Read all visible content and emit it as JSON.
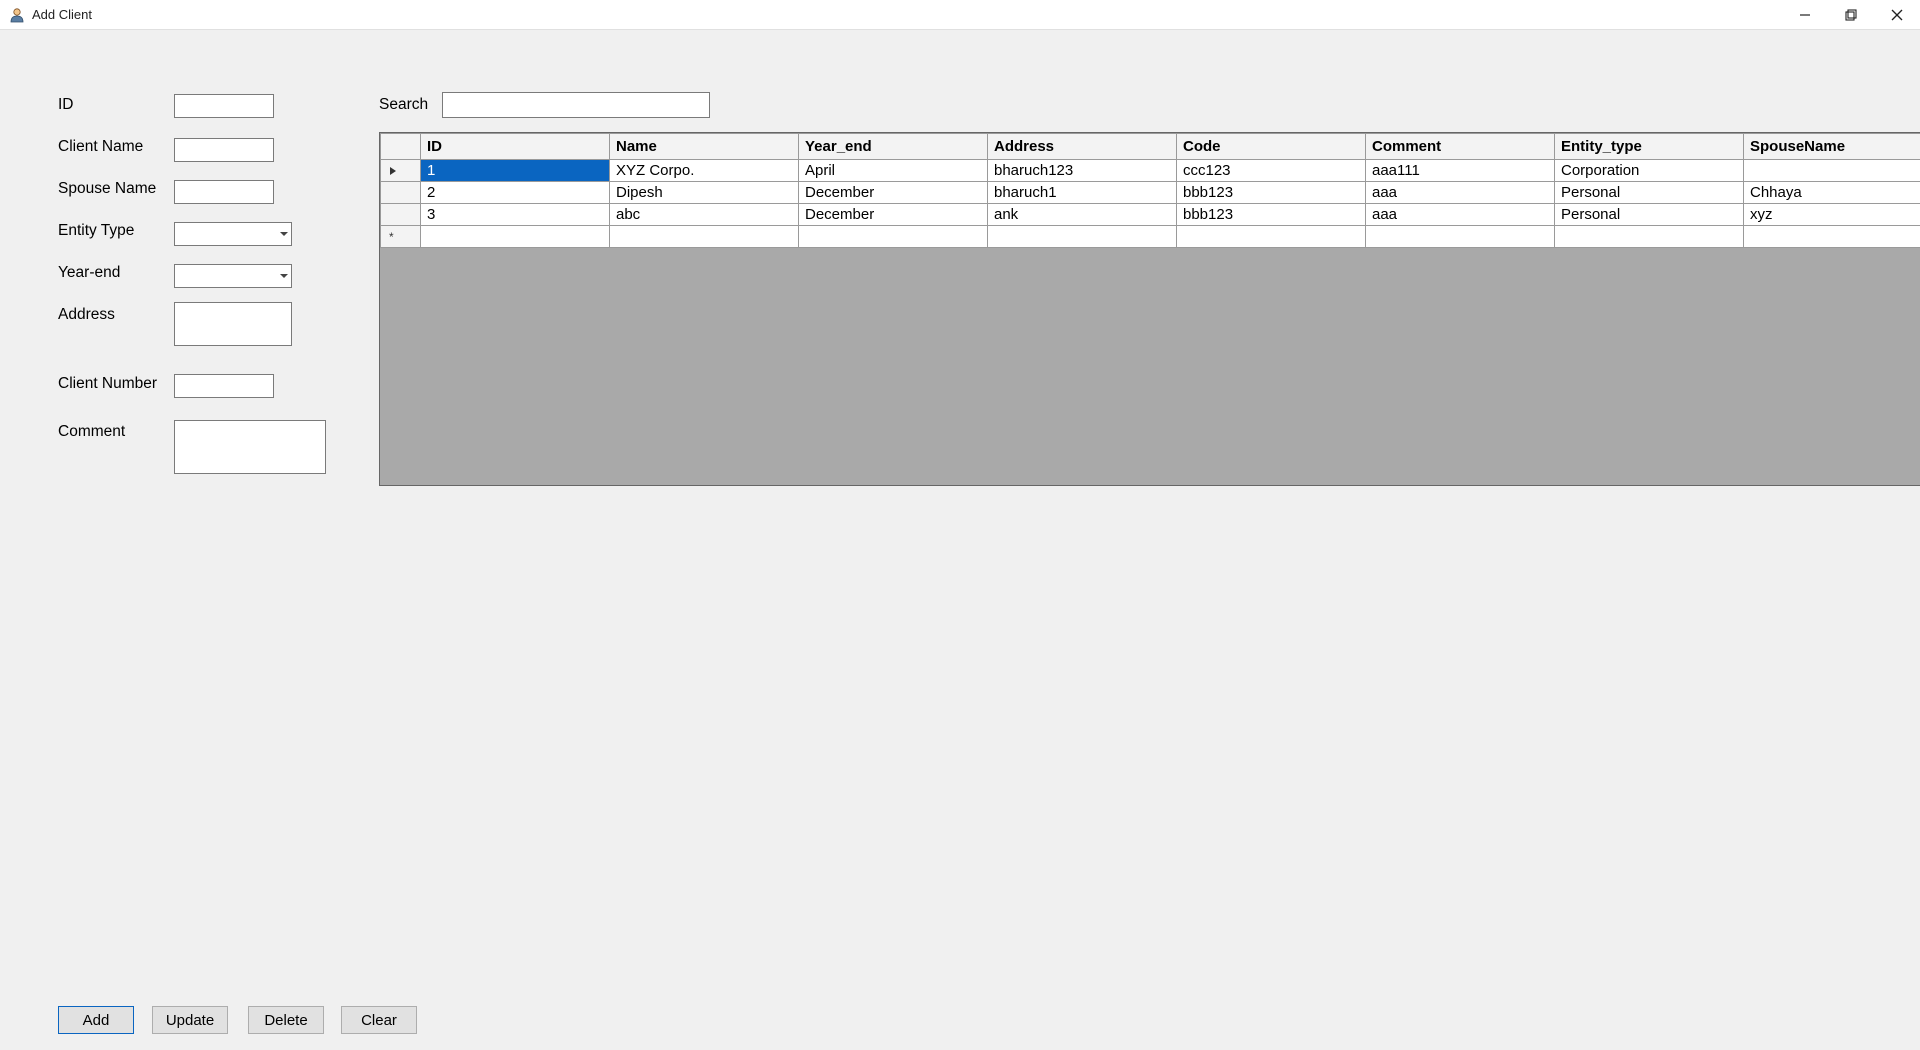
{
  "window": {
    "title": "Add Client"
  },
  "form": {
    "id_label": "ID",
    "client_name_label": "Client Name",
    "spouse_name_label": "Spouse Name",
    "entity_type_label": "Entity Type",
    "year_end_label": "Year-end",
    "address_label": "Address",
    "client_number_label": "Client Number",
    "comment_label": "Comment",
    "id_value": "",
    "client_name_value": "",
    "spouse_name_value": "",
    "entity_type_value": "",
    "year_end_value": "",
    "address_value": "",
    "client_number_value": "",
    "comment_value": ""
  },
  "search": {
    "label": "Search",
    "value": ""
  },
  "grid": {
    "columns": [
      "ID",
      "Name",
      "Year_end",
      "Address",
      "Code",
      "Comment",
      "Entity_type",
      "SpouseName"
    ],
    "rows": [
      {
        "id": "1",
        "name": "XYZ Corpo.",
        "year_end": "April",
        "address": "bharuch123",
        "code": "ccc123",
        "comment": "aaa111",
        "entity_type": "Corporation",
        "spouse": ""
      },
      {
        "id": "2",
        "name": "Dipesh",
        "year_end": "December",
        "address": "bharuch1",
        "code": "bbb123",
        "comment": "aaa",
        "entity_type": "Personal",
        "spouse": "Chhaya"
      },
      {
        "id": "3",
        "name": "abc",
        "year_end": "December",
        "address": "ank",
        "code": "bbb123",
        "comment": "aaa",
        "entity_type": "Personal",
        "spouse": "xyz"
      }
    ]
  },
  "buttons": {
    "add": "Add",
    "update": "Update",
    "delete": "Delete",
    "clear": "Clear"
  }
}
